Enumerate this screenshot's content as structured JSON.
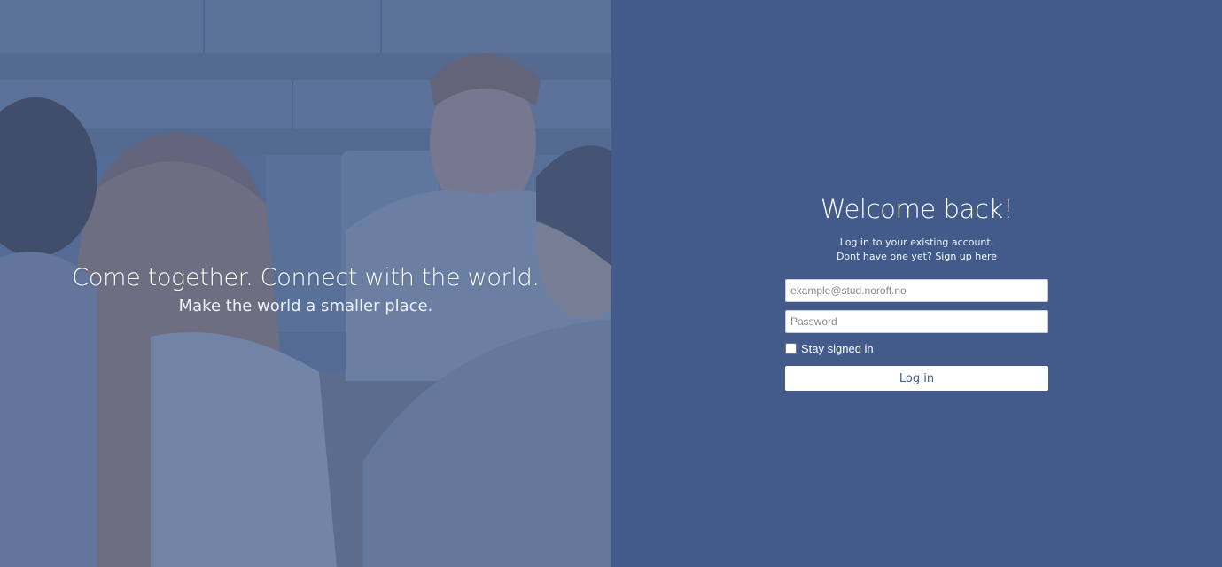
{
  "hero": {
    "headline": "Come together. Connect with the world.",
    "subline": "Make the world a smaller place."
  },
  "login": {
    "title": "Welcome back!",
    "lead": "Log in to your existing account.",
    "signup_prompt": "Dont have one yet?",
    "signup_link": "Sign up here",
    "email_placeholder": "example@stud.noroff.no",
    "password_placeholder": "Password",
    "remember_label": "Stay signed in",
    "remember_checked": false,
    "submit_label": "Log in"
  },
  "colors": {
    "panel_background": "#425b8a",
    "hero_tint": "#425c8c",
    "button_text": "#425b8a"
  }
}
